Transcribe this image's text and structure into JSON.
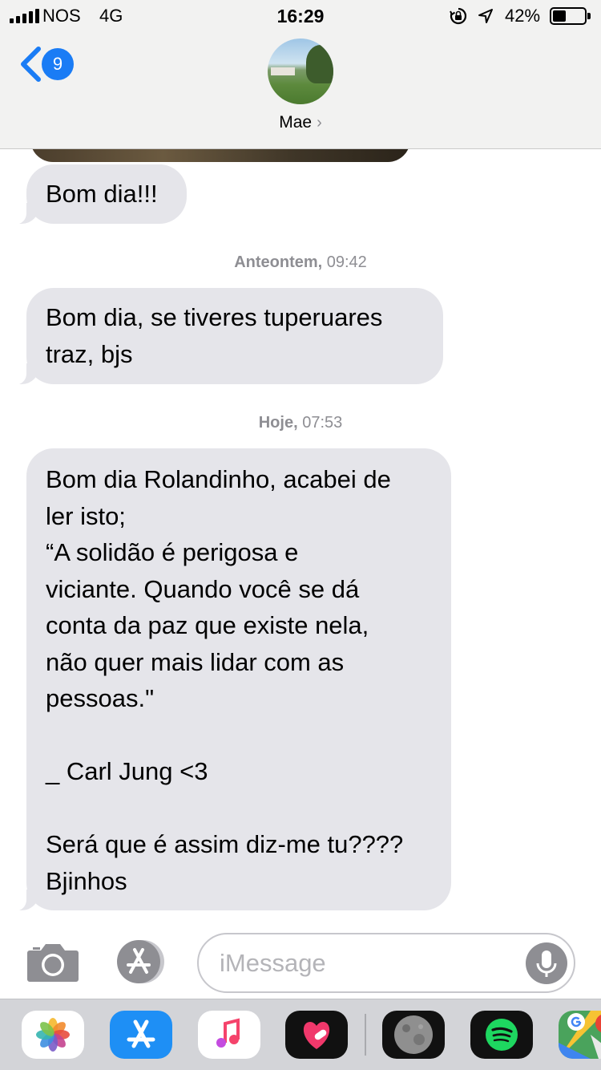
{
  "status_bar": {
    "carrier": "NOS",
    "network": "4G",
    "time": "16:29",
    "battery_percent": "42%",
    "battery_level": 0.42
  },
  "header": {
    "back_badge_count": "9",
    "contact_name": "Mae",
    "contact_arrow": "›"
  },
  "messages": [
    {
      "text": "Bom dia!!!"
    },
    {
      "timestamp_day": "Anteontem,",
      "timestamp_time": "09:42",
      "text": "Bom dia, se tiveres tuperuares\ntraz, bjs"
    },
    {
      "timestamp_day": "Hoje,",
      "timestamp_time": "07:53",
      "text": "Bom dia Rolandinho, acabei de\nler isto;\n“A solidão é perigosa e\nviciante. Quando você se dá\nconta da paz que existe nela,\nnão quer mais lidar com as\npessoas.\"\n\n_ Carl Jung <3\n\nSerá que é assim diz-me tu????\nBjinhos"
    }
  ],
  "input_bar": {
    "placeholder": "iMessage",
    "value": ""
  },
  "app_drawer": [
    {
      "icon": "photos-icon"
    },
    {
      "icon": "app-store-icon"
    },
    {
      "icon": "music-icon"
    },
    {
      "icon": "heart-app-icon"
    },
    {
      "icon": "moon-app-icon"
    },
    {
      "icon": "spotify-icon"
    },
    {
      "icon": "google-maps-icon"
    }
  ],
  "colors": {
    "accent": "#1a7cf5",
    "bubble_received": "#e5e5ea",
    "timestamp": "#8e8e93"
  }
}
